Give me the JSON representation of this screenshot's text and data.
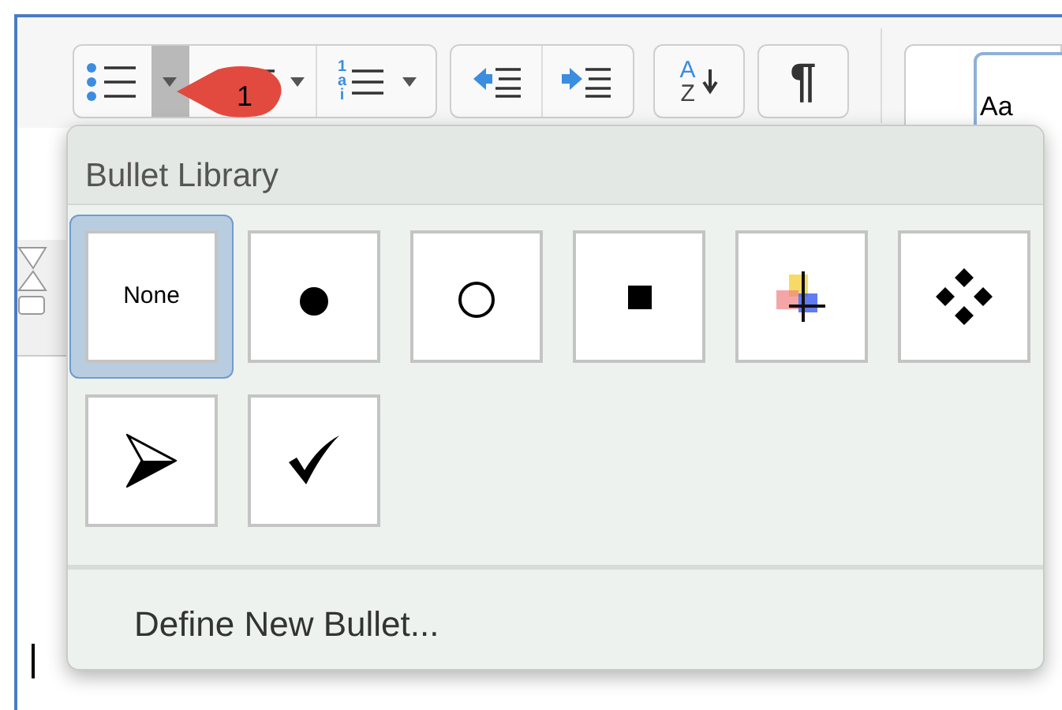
{
  "toolbar": {
    "bullets_dropdown_open": true,
    "multilevel_labels": [
      "1",
      "a",
      "i"
    ],
    "sort_labels": [
      "A",
      "Z"
    ],
    "pilcrow": "¶",
    "style_preview": "Aa"
  },
  "callout": {
    "label": "1"
  },
  "bullet_menu": {
    "title": "Bullet Library",
    "bullets": [
      {
        "kind": "none",
        "label": "None",
        "selected": true
      },
      {
        "kind": "disc",
        "selected": false
      },
      {
        "kind": "circle",
        "selected": false
      },
      {
        "kind": "square",
        "selected": false
      },
      {
        "kind": "picture",
        "selected": false
      },
      {
        "kind": "diamonds",
        "selected": false
      },
      {
        "kind": "arrowhead",
        "selected": false
      },
      {
        "kind": "check",
        "selected": false
      }
    ],
    "define_new": "Define New Bullet..."
  }
}
